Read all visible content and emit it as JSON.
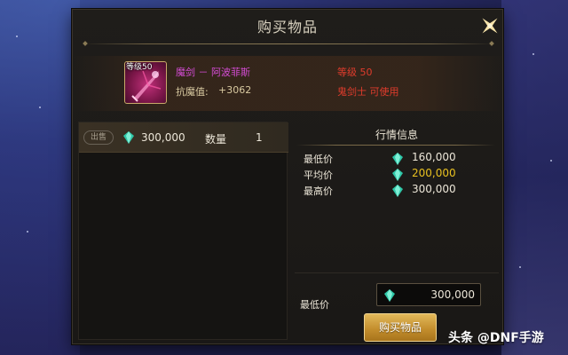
{
  "dialog": {
    "title": "购买物品",
    "close_icon": "close-icon"
  },
  "item": {
    "level_tag": "等级50",
    "name": "魔剑 － 阿波菲斯",
    "stat_label": "抗魔值:",
    "stat_value": "+3062",
    "level_requirement": "等级 50",
    "class_requirement": "鬼剑士 可使用",
    "icon": "sword-item-icon",
    "name_color": "#d44cd4",
    "requirement_color": "#e03c2c"
  },
  "listing": {
    "sell_badge": "出售",
    "price": "300,000",
    "qty_label": "数量",
    "qty": "1",
    "currency_icon": "gem-icon"
  },
  "market": {
    "title": "行情信息",
    "rows": [
      {
        "label": "最低价",
        "value": "160,000"
      },
      {
        "label": "平均价",
        "value": "200,000"
      },
      {
        "label": "最高价",
        "value": "300,000"
      }
    ],
    "average_color": "#e8c020"
  },
  "purchase": {
    "min_price_label": "最低价",
    "min_price_value": "300,000",
    "buy_button_label": "购买物品"
  },
  "watermark": {
    "text": "头条 @DNF手游"
  }
}
